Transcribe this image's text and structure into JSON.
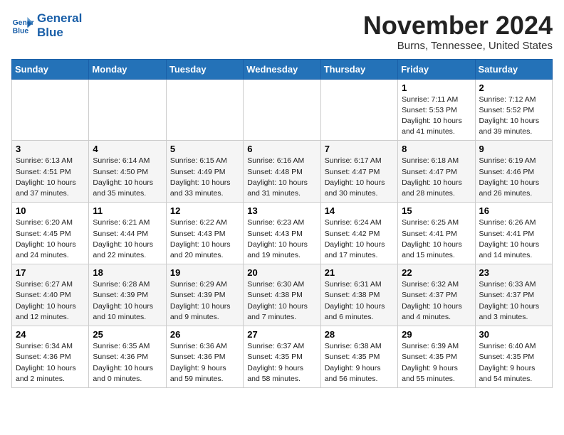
{
  "header": {
    "logo_line1": "General",
    "logo_line2": "Blue",
    "month": "November 2024",
    "location": "Burns, Tennessee, United States"
  },
  "weekdays": [
    "Sunday",
    "Monday",
    "Tuesday",
    "Wednesday",
    "Thursday",
    "Friday",
    "Saturday"
  ],
  "weeks": [
    [
      {
        "day": "",
        "info": ""
      },
      {
        "day": "",
        "info": ""
      },
      {
        "day": "",
        "info": ""
      },
      {
        "day": "",
        "info": ""
      },
      {
        "day": "",
        "info": ""
      },
      {
        "day": "1",
        "info": "Sunrise: 7:11 AM\nSunset: 5:53 PM\nDaylight: 10 hours\nand 41 minutes."
      },
      {
        "day": "2",
        "info": "Sunrise: 7:12 AM\nSunset: 5:52 PM\nDaylight: 10 hours\nand 39 minutes."
      }
    ],
    [
      {
        "day": "3",
        "info": "Sunrise: 6:13 AM\nSunset: 4:51 PM\nDaylight: 10 hours\nand 37 minutes."
      },
      {
        "day": "4",
        "info": "Sunrise: 6:14 AM\nSunset: 4:50 PM\nDaylight: 10 hours\nand 35 minutes."
      },
      {
        "day": "5",
        "info": "Sunrise: 6:15 AM\nSunset: 4:49 PM\nDaylight: 10 hours\nand 33 minutes."
      },
      {
        "day": "6",
        "info": "Sunrise: 6:16 AM\nSunset: 4:48 PM\nDaylight: 10 hours\nand 31 minutes."
      },
      {
        "day": "7",
        "info": "Sunrise: 6:17 AM\nSunset: 4:47 PM\nDaylight: 10 hours\nand 30 minutes."
      },
      {
        "day": "8",
        "info": "Sunrise: 6:18 AM\nSunset: 4:47 PM\nDaylight: 10 hours\nand 28 minutes."
      },
      {
        "day": "9",
        "info": "Sunrise: 6:19 AM\nSunset: 4:46 PM\nDaylight: 10 hours\nand 26 minutes."
      }
    ],
    [
      {
        "day": "10",
        "info": "Sunrise: 6:20 AM\nSunset: 4:45 PM\nDaylight: 10 hours\nand 24 minutes."
      },
      {
        "day": "11",
        "info": "Sunrise: 6:21 AM\nSunset: 4:44 PM\nDaylight: 10 hours\nand 22 minutes."
      },
      {
        "day": "12",
        "info": "Sunrise: 6:22 AM\nSunset: 4:43 PM\nDaylight: 10 hours\nand 20 minutes."
      },
      {
        "day": "13",
        "info": "Sunrise: 6:23 AM\nSunset: 4:43 PM\nDaylight: 10 hours\nand 19 minutes."
      },
      {
        "day": "14",
        "info": "Sunrise: 6:24 AM\nSunset: 4:42 PM\nDaylight: 10 hours\nand 17 minutes."
      },
      {
        "day": "15",
        "info": "Sunrise: 6:25 AM\nSunset: 4:41 PM\nDaylight: 10 hours\nand 15 minutes."
      },
      {
        "day": "16",
        "info": "Sunrise: 6:26 AM\nSunset: 4:41 PM\nDaylight: 10 hours\nand 14 minutes."
      }
    ],
    [
      {
        "day": "17",
        "info": "Sunrise: 6:27 AM\nSunset: 4:40 PM\nDaylight: 10 hours\nand 12 minutes."
      },
      {
        "day": "18",
        "info": "Sunrise: 6:28 AM\nSunset: 4:39 PM\nDaylight: 10 hours\nand 10 minutes."
      },
      {
        "day": "19",
        "info": "Sunrise: 6:29 AM\nSunset: 4:39 PM\nDaylight: 10 hours\nand 9 minutes."
      },
      {
        "day": "20",
        "info": "Sunrise: 6:30 AM\nSunset: 4:38 PM\nDaylight: 10 hours\nand 7 minutes."
      },
      {
        "day": "21",
        "info": "Sunrise: 6:31 AM\nSunset: 4:38 PM\nDaylight: 10 hours\nand 6 minutes."
      },
      {
        "day": "22",
        "info": "Sunrise: 6:32 AM\nSunset: 4:37 PM\nDaylight: 10 hours\nand 4 minutes."
      },
      {
        "day": "23",
        "info": "Sunrise: 6:33 AM\nSunset: 4:37 PM\nDaylight: 10 hours\nand 3 minutes."
      }
    ],
    [
      {
        "day": "24",
        "info": "Sunrise: 6:34 AM\nSunset: 4:36 PM\nDaylight: 10 hours\nand 2 minutes."
      },
      {
        "day": "25",
        "info": "Sunrise: 6:35 AM\nSunset: 4:36 PM\nDaylight: 10 hours\nand 0 minutes."
      },
      {
        "day": "26",
        "info": "Sunrise: 6:36 AM\nSunset: 4:36 PM\nDaylight: 9 hours\nand 59 minutes."
      },
      {
        "day": "27",
        "info": "Sunrise: 6:37 AM\nSunset: 4:35 PM\nDaylight: 9 hours\nand 58 minutes."
      },
      {
        "day": "28",
        "info": "Sunrise: 6:38 AM\nSunset: 4:35 PM\nDaylight: 9 hours\nand 56 minutes."
      },
      {
        "day": "29",
        "info": "Sunrise: 6:39 AM\nSunset: 4:35 PM\nDaylight: 9 hours\nand 55 minutes."
      },
      {
        "day": "30",
        "info": "Sunrise: 6:40 AM\nSunset: 4:35 PM\nDaylight: 9 hours\nand 54 minutes."
      }
    ]
  ]
}
